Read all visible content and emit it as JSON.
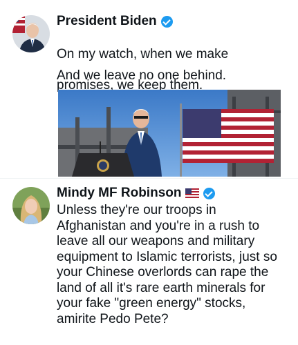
{
  "posts": [
    {
      "author": "President Biden",
      "verified": true,
      "text_lines": [
        "On my watch, when we make",
        "promises, we keep them."
      ],
      "text_line2": "And we leave no one behind.",
      "avatar": "biden-avatar",
      "has_image": true
    },
    {
      "author": "Mindy MF Robinson",
      "verified": true,
      "flag": "us-flag-icon",
      "text": "Unless they're our troops in\nAfghanistan and you're in a rush to\nleave all our weapons and military\nequipment to Islamic terrorists, just so\nyour Chinese overlords can rape the\nland of all it's rare earth minerals for\nyour fake \"green energy\" stocks,\namirite Pedo Pete?",
      "avatar": "robinson-avatar"
    }
  ],
  "colors": {
    "verified": "#1d9bf0",
    "text": "#0f1419"
  }
}
